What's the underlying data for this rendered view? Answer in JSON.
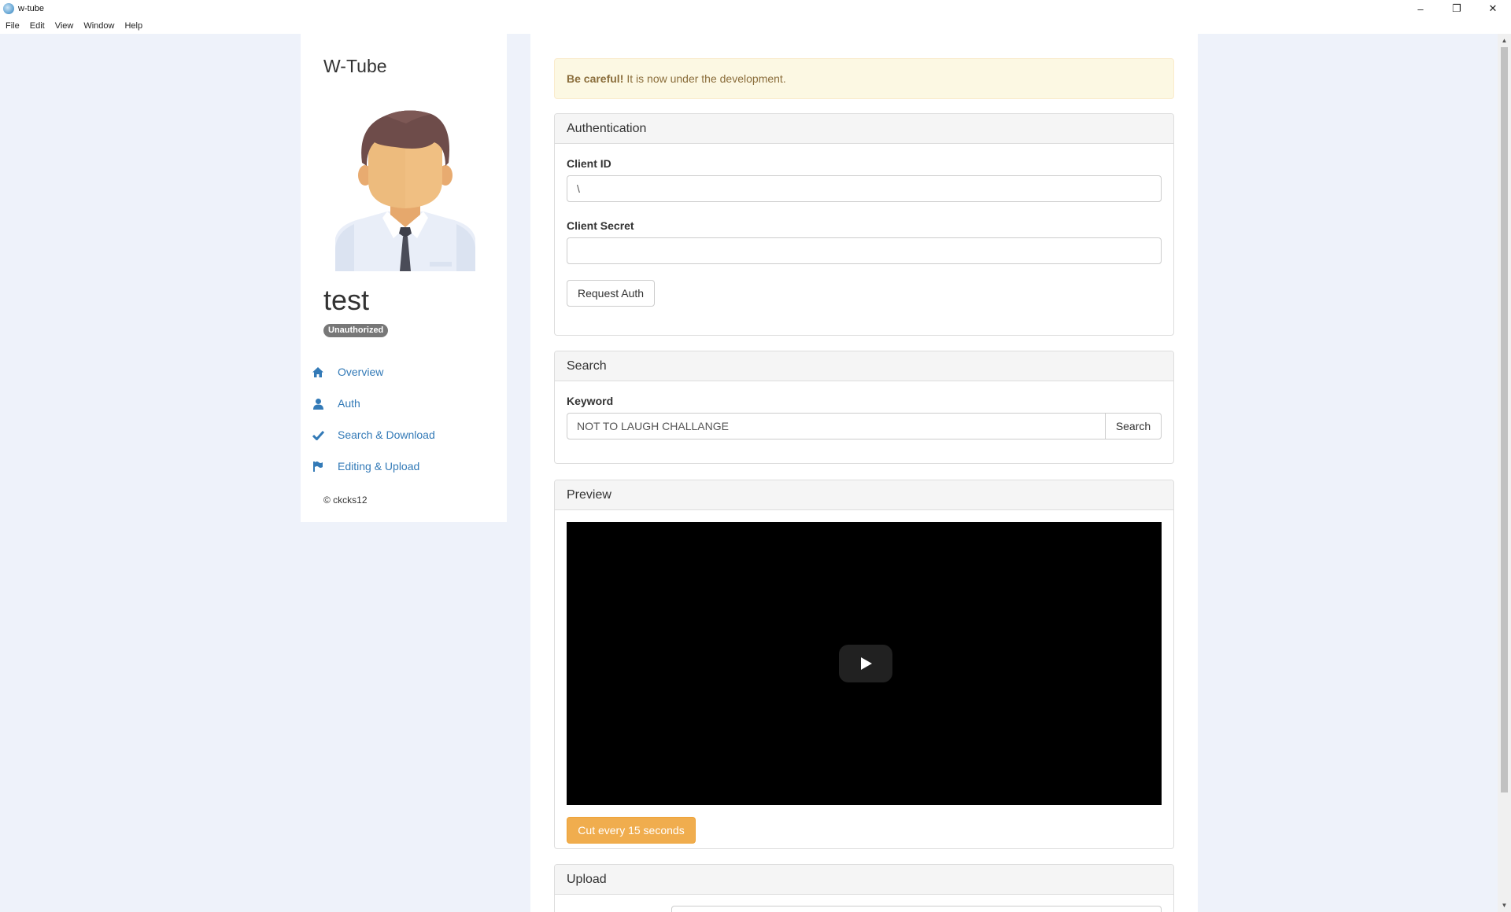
{
  "window": {
    "title": "w-tube",
    "controls": {
      "minimize": "–",
      "restore": "❐",
      "close": "✕"
    }
  },
  "menu": [
    "File",
    "Edit",
    "View",
    "Window",
    "Help"
  ],
  "sidebar": {
    "brand": "W-Tube",
    "username": "test",
    "status_badge": "Unauthorized",
    "nav": [
      {
        "label": "Overview",
        "icon": "home-icon"
      },
      {
        "label": "Auth",
        "icon": "user-icon"
      },
      {
        "label": "Search & Download",
        "icon": "check-icon"
      },
      {
        "label": "Editing & Upload",
        "icon": "flag-icon"
      }
    ],
    "footer": "© ckcks12"
  },
  "main": {
    "alert": {
      "strong": "Be careful!",
      "text": "It is now under the development."
    },
    "auth": {
      "heading": "Authentication",
      "client_id_label": "Client ID",
      "client_id_value": "\\",
      "client_secret_label": "Client Secret",
      "client_secret_value": "",
      "request_button": "Request Auth"
    },
    "search": {
      "heading": "Search",
      "keyword_label": "Keyword",
      "keyword_value": "NOT TO LAUGH CHALLANGE",
      "search_button": "Search"
    },
    "preview": {
      "heading": "Preview",
      "cut_button": "Cut every 15 seconds"
    },
    "upload": {
      "heading": "Upload"
    }
  },
  "colors": {
    "accent_link": "#337ab7",
    "warning_button": "#f0ad4e",
    "alert_bg": "#fcf8e3",
    "page_bg": "#eef2fa"
  }
}
